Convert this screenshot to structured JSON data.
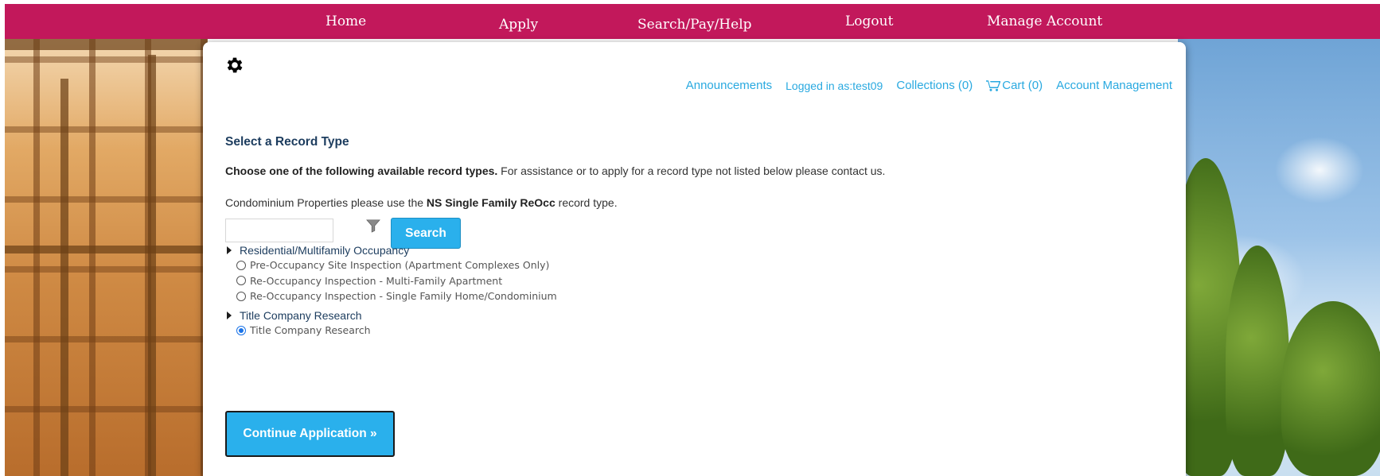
{
  "nav": {
    "home": "Home",
    "apply": "Apply",
    "search_pay_help": "Search/Pay/Help",
    "logout": "Logout",
    "manage_account": "Manage Account"
  },
  "header": {
    "announcements": "Announcements",
    "logged_in": "Logged in as:test09",
    "collections": "Collections (0)",
    "cart": "Cart (0)",
    "account_management": "Account Management"
  },
  "main": {
    "title": "Select a Record Type",
    "instr1_bold": "Choose one of the following available record types.",
    "instr1_rest": " For assistance or to apply for a record type not listed below please contact us.",
    "instr2_pre": "Condominium Properties please use the ",
    "instr2_bold": "NS Single Family ReOcc",
    "instr2_post": " record type.",
    "search_value": "",
    "search_label": "Search",
    "continue_label": "Continue Application »"
  },
  "groups": [
    {
      "label": "Residential/Multifamily Occupancy",
      "options": [
        {
          "label": "Pre-Occupancy Site Inspection (Apartment Complexes Only)",
          "checked": false
        },
        {
          "label": "Re-Occupancy Inspection - Multi-Family Apartment",
          "checked": false
        },
        {
          "label": "Re-Occupancy Inspection - Single Family Home/Condominium",
          "checked": false
        }
      ]
    },
    {
      "label": "Title Company Research",
      "options": [
        {
          "label": "Title Company Research",
          "checked": true
        }
      ]
    }
  ],
  "colors": {
    "nav_bg": "#c2185b",
    "link": "#29a9e0",
    "button": "#2ab0ec",
    "heading": "#1c3c5e"
  },
  "icons": [
    "gear-icon",
    "cart-icon",
    "filter-icon",
    "expand-triangle-icon"
  ]
}
